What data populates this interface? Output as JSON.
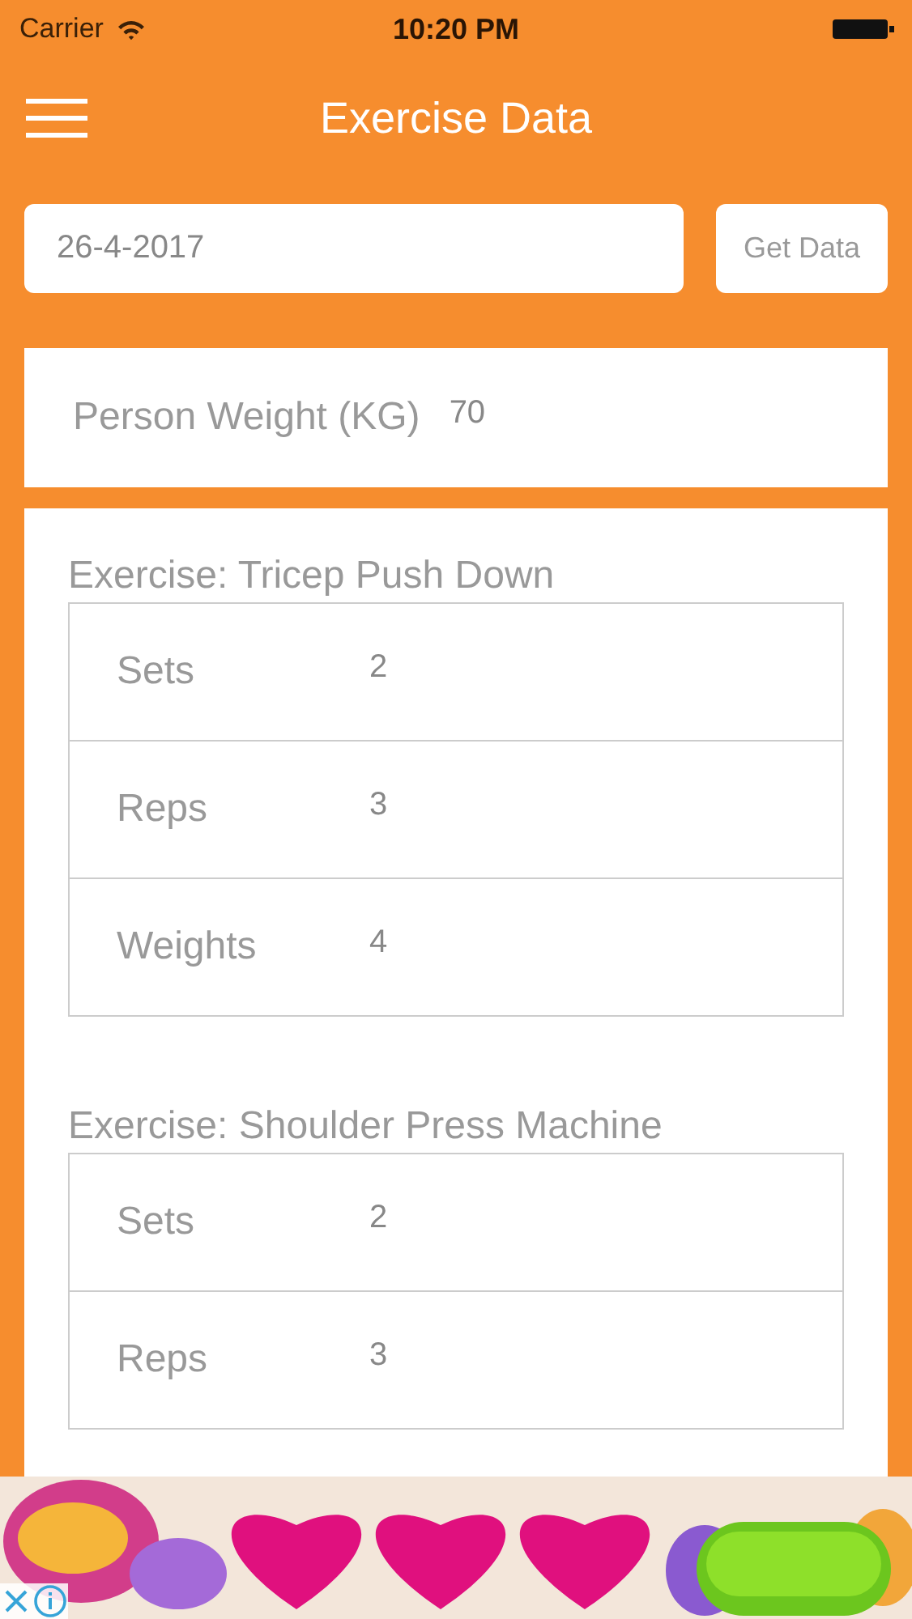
{
  "status_bar": {
    "carrier": "Carrier",
    "time": "10:20 PM"
  },
  "nav": {
    "title": "Exercise Data"
  },
  "date_field": {
    "value": "26-4-2017"
  },
  "get_button": "Get Data",
  "weight": {
    "label": "Person Weight (KG)",
    "value": "70"
  },
  "exercises": [
    {
      "title": "Exercise: Tricep Push Down",
      "rows": [
        {
          "label": "Sets",
          "value": "2"
        },
        {
          "label": "Reps",
          "value": "3"
        },
        {
          "label": "Weights",
          "value": "4"
        }
      ]
    },
    {
      "title": "Exercise: Shoulder Press Machine",
      "rows": [
        {
          "label": "Sets",
          "value": "2"
        },
        {
          "label": "Reps",
          "value": "3"
        }
      ]
    }
  ]
}
